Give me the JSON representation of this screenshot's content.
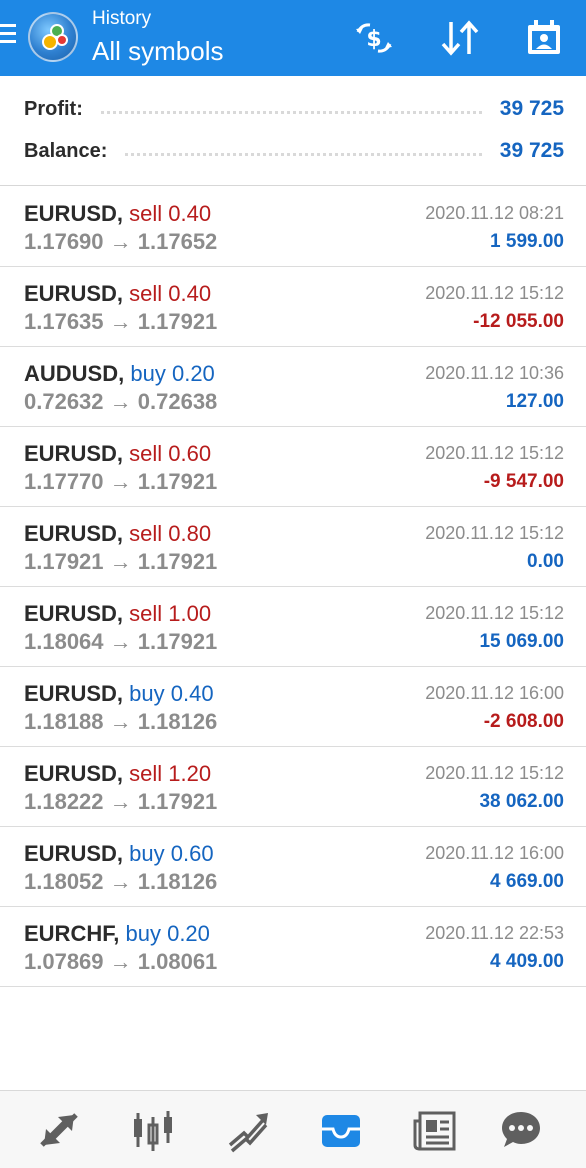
{
  "header": {
    "subtitle": "History",
    "title": "All symbols",
    "accent_color": "#1e88e5",
    "actions": [
      {
        "icon": "currency-exchange-icon"
      },
      {
        "icon": "sort-icon"
      },
      {
        "icon": "calendar-icon"
      }
    ]
  },
  "summary": {
    "profit_label": "Profit:",
    "profit_value": "39 725",
    "balance_label": "Balance:",
    "balance_value": "39 725"
  },
  "colors": {
    "sell": "#b71c1c",
    "buy": "#1565c0",
    "profit_positive": "#1565c0",
    "profit_negative": "#b71c1c"
  },
  "deals": [
    {
      "symbol": "EURUSD,",
      "side": "sell",
      "volume": "0.40",
      "open": "1.17690",
      "close": "1.17652",
      "time": "2020.11.12 08:21",
      "profit": "1 599.00",
      "profit_sign": "pos"
    },
    {
      "symbol": "EURUSD,",
      "side": "sell",
      "volume": "0.40",
      "open": "1.17635",
      "close": "1.17921",
      "time": "2020.11.12 15:12",
      "profit": "-12 055.00",
      "profit_sign": "neg"
    },
    {
      "symbol": "AUDUSD,",
      "side": "buy",
      "volume": "0.20",
      "open": "0.72632",
      "close": "0.72638",
      "time": "2020.11.12 10:36",
      "profit": "127.00",
      "profit_sign": "pos"
    },
    {
      "symbol": "EURUSD,",
      "side": "sell",
      "volume": "0.60",
      "open": "1.17770",
      "close": "1.17921",
      "time": "2020.11.12 15:12",
      "profit": "-9 547.00",
      "profit_sign": "neg"
    },
    {
      "symbol": "EURUSD,",
      "side": "sell",
      "volume": "0.80",
      "open": "1.17921",
      "close": "1.17921",
      "time": "2020.11.12 15:12",
      "profit": "0.00",
      "profit_sign": "pos"
    },
    {
      "symbol": "EURUSD,",
      "side": "sell",
      "volume": "1.00",
      "open": "1.18064",
      "close": "1.17921",
      "time": "2020.11.12 15:12",
      "profit": "15 069.00",
      "profit_sign": "pos"
    },
    {
      "symbol": "EURUSD,",
      "side": "buy",
      "volume": "0.40",
      "open": "1.18188",
      "close": "1.18126",
      "time": "2020.11.12 16:00",
      "profit": "-2 608.00",
      "profit_sign": "neg"
    },
    {
      "symbol": "EURUSD,",
      "side": "sell",
      "volume": "1.20",
      "open": "1.18222",
      "close": "1.17921",
      "time": "2020.11.12 15:12",
      "profit": "38 062.00",
      "profit_sign": "pos"
    },
    {
      "symbol": "EURUSD,",
      "side": "buy",
      "volume": "0.60",
      "open": "1.18052",
      "close": "1.18126",
      "time": "2020.11.12 16:00",
      "profit": "4 669.00",
      "profit_sign": "pos"
    },
    {
      "symbol": "EURCHF,",
      "side": "buy",
      "volume": "0.20",
      "open": "1.07869",
      "close": "1.08061",
      "time": "2020.11.12 22:53",
      "profit": "4 409.00",
      "profit_sign": "pos"
    }
  ],
  "bottom_nav": [
    {
      "icon": "quotes-icon",
      "active": false
    },
    {
      "icon": "chart-icon",
      "active": false
    },
    {
      "icon": "trade-icon",
      "active": false
    },
    {
      "icon": "history-icon",
      "active": true
    },
    {
      "icon": "news-icon",
      "active": false
    },
    {
      "icon": "chat-icon",
      "active": false
    }
  ],
  "nav_active_color": "#1e88e5",
  "nav_inactive_color": "#5f5f5f"
}
